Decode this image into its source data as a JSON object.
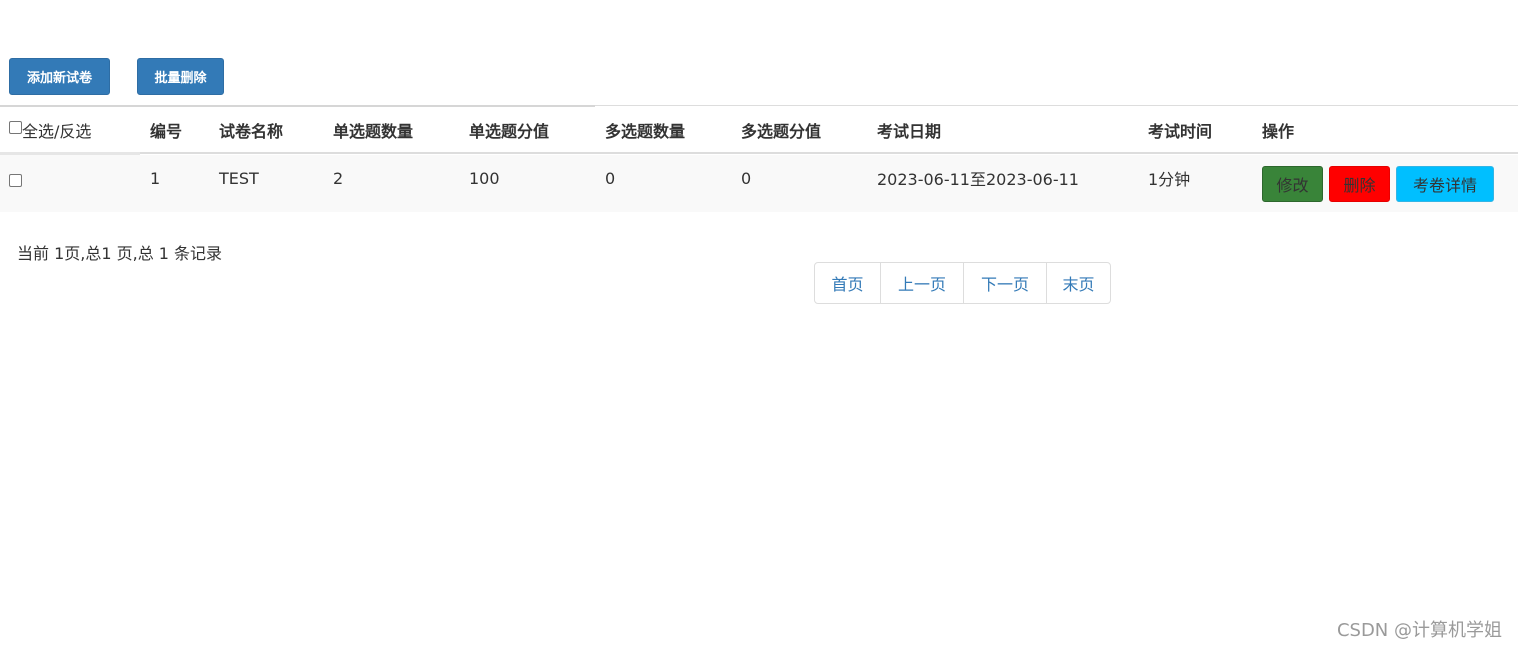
{
  "toolbar": {
    "add_label": "添加新试卷",
    "batch_delete_label": "批量删除"
  },
  "table": {
    "headers": {
      "select_all": "全选/反选",
      "id": "编号",
      "name": "试卷名称",
      "single_count": "单选题数量",
      "single_score": "单选题分值",
      "multi_count": "多选题数量",
      "multi_score": "多选题分值",
      "exam_date": "考试日期",
      "exam_time": "考试时间",
      "actions": "操作"
    },
    "rows": [
      {
        "id": "1",
        "name": "TEST",
        "single_count": "2",
        "single_score": "100",
        "multi_count": "0",
        "multi_score": "0",
        "exam_date": "2023-06-11至2023-06-11",
        "exam_time": "1分钟",
        "edit_label": "修改",
        "delete_label": "删除",
        "detail_label": "考卷详情"
      }
    ]
  },
  "pagination": {
    "info": "当前 1页,总1 页,总 1 条记录",
    "first": "首页",
    "prev": "上一页",
    "next": "下一页",
    "last": "末页"
  },
  "watermark": "CSDN @计算机学姐",
  "colors": {
    "primary": "#337ab7",
    "edit": "#398439",
    "delete": "#ff0000",
    "detail": "#00bfff"
  }
}
